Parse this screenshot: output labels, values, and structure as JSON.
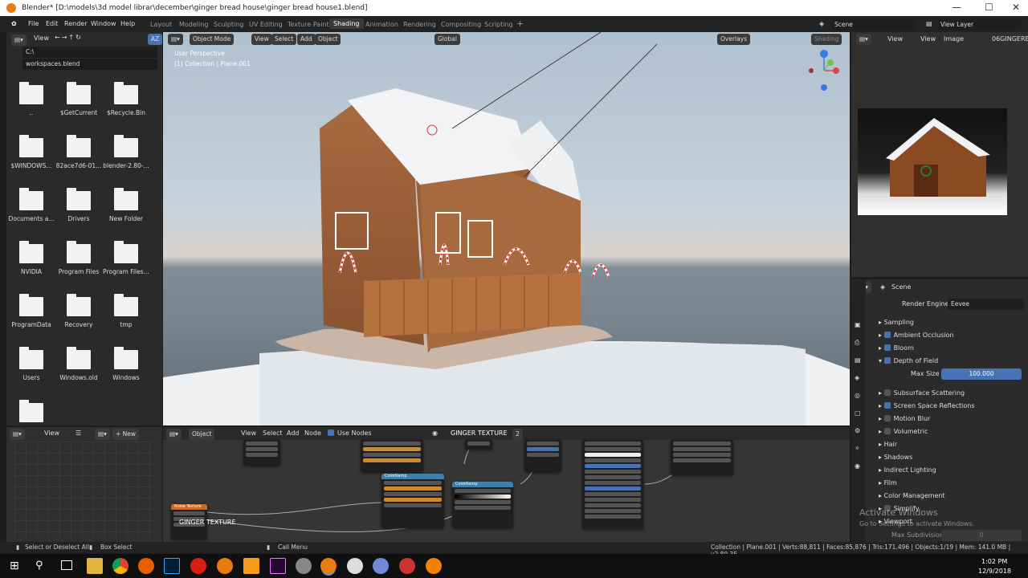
{
  "window": {
    "title": "Blender* [D:\\models\\3d model librar\\december\\ginger bread house\\ginger bread house1.blend]"
  },
  "menu": [
    "File",
    "Edit",
    "Render",
    "Window",
    "Help"
  ],
  "workspaces": [
    "Layout",
    "Modeling",
    "Sculpting",
    "UV Editing",
    "Texture Paint",
    "Shading",
    "Animation",
    "Rendering",
    "Compositing",
    "Scripting"
  ],
  "scene": {
    "label": "Scene",
    "view_layer": "View Layer"
  },
  "filebrowser": {
    "view": "View",
    "path": "C:\\",
    "file": "workspaces.blend",
    "items": [
      "..",
      "$GetCurrent",
      "$Recycle.Bin",
      "$WINDOWS...",
      "82ace7d6-01...",
      "blender-2.80-...",
      "Documents a...",
      "Drivers",
      "New Folder",
      "NVIDIA",
      "Program Files",
      "Program Files...",
      "ProgramData",
      "Recovery",
      "tmp",
      "Users",
      "Windows.old",
      "Windows",
      ""
    ]
  },
  "viewport": {
    "mode": "Object Mode",
    "view": "View",
    "select": "Select",
    "add": "Add",
    "object": "Object",
    "transform": "Global",
    "overlays": "Overlays",
    "shading": "Shading",
    "info1": "User Perspective",
    "info2": "(1) Collection | Plane.001"
  },
  "image_editor": {
    "view": "View",
    "view2": "View",
    "image": "Image",
    "name": "06GINGERB"
  },
  "props": {
    "header": "Scene",
    "render_engine_label": "Render Engine",
    "render_engine": "Eevee",
    "rows": [
      {
        "label": "Sampling",
        "cb": null
      },
      {
        "label": "Ambient Occlusion",
        "cb": true
      },
      {
        "label": "Bloom",
        "cb": true
      },
      {
        "label": "Depth of Field",
        "cb": true
      },
      {
        "label": "Subsurface Scattering",
        "cb": false
      },
      {
        "label": "Screen Space Reflections",
        "cb": true
      },
      {
        "label": "Motion Blur",
        "cb": false
      },
      {
        "label": "Volumetric",
        "cb": false
      },
      {
        "label": "Hair",
        "cb": null
      },
      {
        "label": "Shadows",
        "cb": null
      },
      {
        "label": "Indirect Lighting",
        "cb": null
      },
      {
        "label": "Film",
        "cb": null
      },
      {
        "label": "Color Management",
        "cb": null
      },
      {
        "label": "Simplify",
        "cb": false
      },
      {
        "label": "Viewport",
        "cb": null
      }
    ],
    "max_size_label": "Max Size",
    "max_size": "100.000",
    "max_subdiv_label": "Max Subdivision",
    "max_subdiv": "0"
  },
  "activate": {
    "line1": "Activate Windows",
    "line2": "Go to Settings to activate Windows."
  },
  "left_bottom": {
    "view": "View",
    "new": "New"
  },
  "node_editor": {
    "object": "Object",
    "view": "View",
    "select": "Select",
    "add": "Add",
    "node": "Node",
    "use_nodes": "Use Nodes",
    "material": "GINGER TEXTURE",
    "users": "2",
    "frame_label": "GINGER TEXTURE"
  },
  "status": {
    "left1": "Select or Deselect All",
    "left2": "Box Select",
    "left3": "Call Menu",
    "right": "Collection | Plane.001 | Verts:88,811 | Faces:85,876 | Tris:171,496 | Objects:1/19 | Mem: 141.0 MB | v2.80.35"
  },
  "clock": {
    "time": "1:02 PM",
    "date": "12/9/2018"
  },
  "colors": {
    "accent": "#4772b3",
    "node_orange": "#d08a2b",
    "bg": "#1d1d1d"
  }
}
